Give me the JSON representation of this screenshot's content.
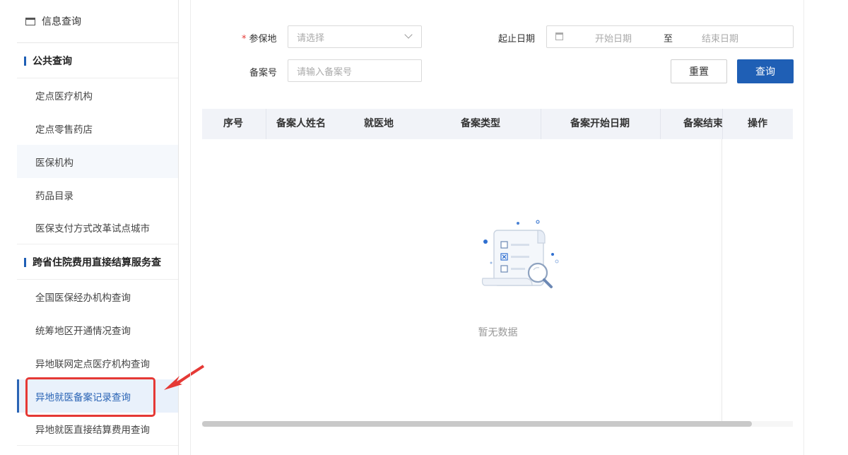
{
  "sidebar": {
    "title": "信息查询",
    "groups": [
      {
        "label": "公共查询",
        "items": [
          {
            "label": "定点医疗机构"
          },
          {
            "label": "定点零售药店"
          },
          {
            "label": "医保机构"
          },
          {
            "label": "药品目录"
          },
          {
            "label": "医保支付方式改革试点城市"
          }
        ]
      },
      {
        "label": "跨省住院费用直接结算服务查",
        "items": [
          {
            "label": "全国医保经办机构查询"
          },
          {
            "label": "统筹地区开通情况查询"
          },
          {
            "label": "异地联网定点医疗机构查询"
          },
          {
            "label": "异地就医备案记录查询"
          },
          {
            "label": "异地就医直接结算费用查询"
          }
        ]
      }
    ]
  },
  "form": {
    "insured_place": {
      "label": "参保地",
      "required_mark": "*",
      "placeholder": "请选择"
    },
    "date_range": {
      "label": "起止日期",
      "start_placeholder": "开始日期",
      "separator": "至",
      "end_placeholder": "结束日期"
    },
    "record_no": {
      "label": "备案号",
      "placeholder": "请输入备案号"
    },
    "reset_label": "重置",
    "query_label": "查询"
  },
  "table": {
    "columns": [
      "序号",
      "备案人姓名",
      "就医地",
      "备案类型",
      "备案开始日期",
      "备案结束",
      "操作"
    ],
    "empty_text": "暂无数据"
  },
  "colors": {
    "primary": "#1f5fb5",
    "highlight": "#e53935"
  }
}
